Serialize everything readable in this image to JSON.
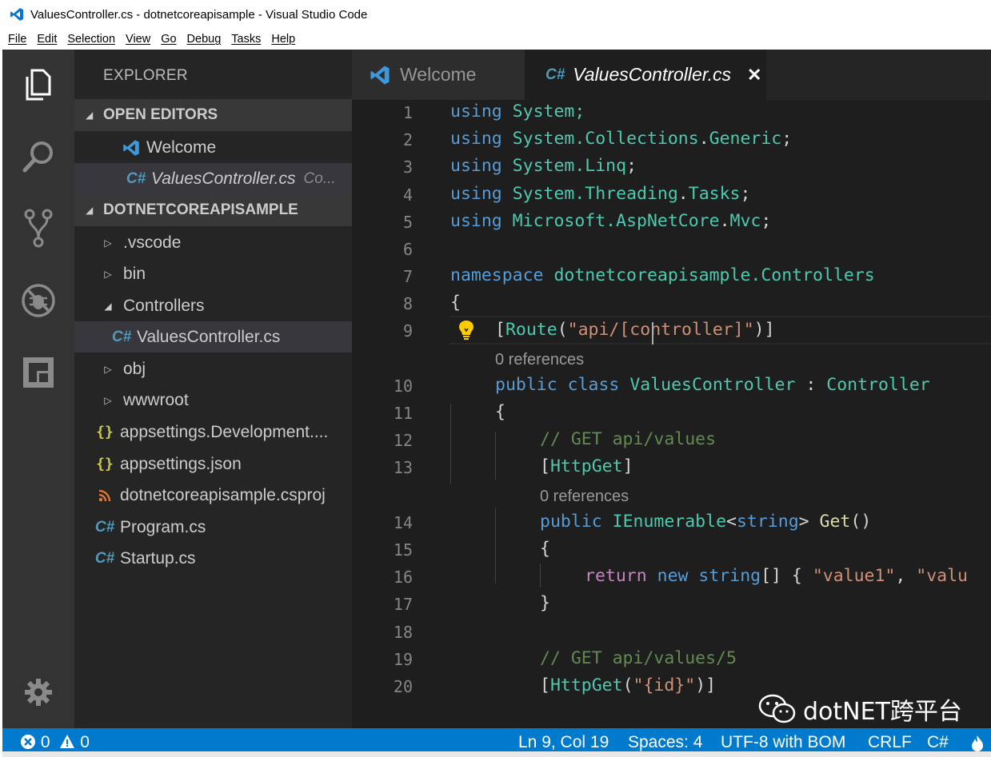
{
  "window": {
    "title": "ValuesController.cs - dotnetcoreapisample - Visual Studio Code"
  },
  "menu": [
    "File",
    "Edit",
    "Selection",
    "View",
    "Go",
    "Debug",
    "Tasks",
    "Help"
  ],
  "activity_bar": [
    "files-icon",
    "search-icon",
    "source-control-icon",
    "debug-icon",
    "extensions-icon",
    "settings-gear-icon"
  ],
  "sidebar": {
    "title": "EXPLORER",
    "open_editors": {
      "header": "OPEN EDITORS",
      "items": [
        {
          "name": "Welcome",
          "icon": "vscode-icon"
        },
        {
          "name": "ValuesController.cs",
          "desc": "Co...",
          "icon": "csharp-icon"
        }
      ]
    },
    "project": {
      "header": "DOTNETCOREAPISAMPLE",
      "items": [
        {
          "name": ".vscode",
          "type": "folder",
          "expanded": false
        },
        {
          "name": "bin",
          "type": "folder",
          "expanded": false
        },
        {
          "name": "Controllers",
          "type": "folder",
          "expanded": true
        },
        {
          "name": "ValuesController.cs",
          "type": "csharp",
          "selected": true
        },
        {
          "name": "obj",
          "type": "folder",
          "expanded": false
        },
        {
          "name": "wwwroot",
          "type": "folder",
          "expanded": false
        },
        {
          "name": "appsettings.Development....",
          "type": "json"
        },
        {
          "name": "appsettings.json",
          "type": "json"
        },
        {
          "name": "dotnetcoreapisample.csproj",
          "type": "rss"
        },
        {
          "name": "Program.cs",
          "type": "csharp"
        },
        {
          "name": "Startup.cs",
          "type": "csharp"
        }
      ]
    }
  },
  "tabs": [
    {
      "label": "Welcome",
      "active": false
    },
    {
      "label": "ValuesController.cs",
      "active": true
    }
  ],
  "editor": {
    "line_numbers": [
      "1",
      "2",
      "3",
      "4",
      "5",
      "6",
      "7",
      "8",
      "9",
      "10",
      "11",
      "12",
      "13",
      "14",
      "15",
      "16",
      "17",
      "18",
      "19",
      "20"
    ],
    "codelens": [
      "0 references",
      "0 references"
    ],
    "code": {
      "l1": [
        "using",
        " System;"
      ],
      "l2": [
        "using",
        " System.",
        "Collections",
        ".",
        "Generic",
        ";"
      ],
      "l3": [
        "using",
        " System.",
        "Linq",
        ";"
      ],
      "l4": [
        "using",
        " System.",
        "Threading",
        ".",
        "Tasks",
        ";"
      ],
      "l5": [
        "using",
        " Microsoft.",
        "AspNetCore",
        ".",
        "Mvc",
        ";"
      ],
      "l7": [
        "namespace",
        " dotnetcoreapisample.",
        "Controllers"
      ],
      "l8": "{",
      "l9": [
        "[",
        "Route",
        "(",
        "\"api/[controller]\"",
        ")]"
      ],
      "l10": [
        "public",
        " ",
        "class",
        " ",
        "ValuesController",
        " : ",
        "Controller"
      ],
      "l11": "{",
      "l12": "// GET api/values",
      "l13": [
        "[",
        "HttpGet",
        "]"
      ],
      "l14": [
        "public",
        " ",
        "IEnumerable",
        "<",
        "string",
        "> ",
        "Get",
        "()"
      ],
      "l15": "{",
      "l16": [
        "return",
        " ",
        "new",
        " ",
        "string",
        "[] { ",
        "\"value1\"",
        ", ",
        "\"valu"
      ],
      "l17": "}",
      "l19": "// GET api/values/5",
      "l20": [
        "[",
        "HttpGet",
        "(",
        "\"{id}\"",
        ")]"
      ]
    }
  },
  "status": {
    "errors": "0",
    "warnings": "0",
    "position": "Ln 9, Col 19",
    "spaces": "Spaces: 4",
    "encoding": "UTF-8 with BOM",
    "eol": "CRLF",
    "language": "C#"
  },
  "watermark": "dotNET跨平台",
  "colors": {
    "keyword": "#569cd6",
    "type": "#4ec9b0",
    "string": "#ce9178",
    "comment": "#608b4e",
    "control": "#c586c0",
    "function": "#dcdcaa",
    "statusbar": "#007acc"
  }
}
